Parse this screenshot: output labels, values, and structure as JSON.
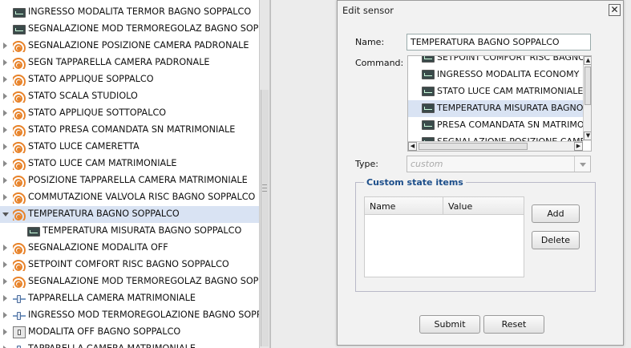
{
  "tree": {
    "items": [
      {
        "label": "INGRESSO MODALITA TERMOR BAGNO SOPPALCO",
        "icon": "sensor-monitor-icon",
        "expander": "none",
        "indent": 1,
        "selected": false
      },
      {
        "label": "SEGNALAZIONE MOD TERMOREGOLAZ BAGNO SOPPA",
        "icon": "sensor-monitor-icon",
        "expander": "none",
        "indent": 1,
        "selected": false
      },
      {
        "label": "SEGNALAZIONE POSIZIONE CAMERA PADRONALE",
        "icon": "signal-icon",
        "expander": "collapsed",
        "indent": 0,
        "selected": false
      },
      {
        "label": "SEGN TAPPARELLA CAMERA PADRONALE",
        "icon": "signal-icon",
        "expander": "collapsed",
        "indent": 0,
        "selected": false
      },
      {
        "label": "STATO APPLIQUE SOPPALCO",
        "icon": "signal-icon",
        "expander": "collapsed",
        "indent": 0,
        "selected": false
      },
      {
        "label": "STATO SCALA STUDIOLO",
        "icon": "signal-icon",
        "expander": "collapsed",
        "indent": 0,
        "selected": false
      },
      {
        "label": "STATO APPLIQUE SOTTOPALCO",
        "icon": "signal-icon",
        "expander": "collapsed",
        "indent": 0,
        "selected": false
      },
      {
        "label": "STATO PRESA COMANDATA SN MATRIMONIALE",
        "icon": "signal-icon",
        "expander": "collapsed",
        "indent": 0,
        "selected": false
      },
      {
        "label": "STATO LUCE CAMERETTA",
        "icon": "signal-icon",
        "expander": "collapsed",
        "indent": 0,
        "selected": false
      },
      {
        "label": "STATO LUCE CAM MATRIMONIALE",
        "icon": "signal-icon",
        "expander": "collapsed",
        "indent": 0,
        "selected": false
      },
      {
        "label": "POSIZIONE TAPPARELLA CAMERA MATRIMONIALE",
        "icon": "signal-icon",
        "expander": "collapsed",
        "indent": 0,
        "selected": false
      },
      {
        "label": "COMMUTAZIONE VALVOLA RISC BAGNO SOPPALCO",
        "icon": "signal-icon",
        "expander": "collapsed",
        "indent": 0,
        "selected": false
      },
      {
        "label": "TEMPERATURA BAGNO SOPPALCO",
        "icon": "signal-icon",
        "expander": "expanded",
        "indent": 0,
        "selected": true
      },
      {
        "label": "TEMPERATURA MISURATA BAGNO SOPPALCO",
        "icon": "sensor-monitor-icon",
        "expander": "none",
        "indent": 2,
        "selected": false
      },
      {
        "label": "SEGNALAZIONE MODALITA OFF",
        "icon": "signal-icon",
        "expander": "collapsed",
        "indent": 0,
        "selected": false
      },
      {
        "label": "SETPOINT COMFORT RISC BAGNO SOPPALCO",
        "icon": "signal-icon",
        "expander": "collapsed",
        "indent": 0,
        "selected": false
      },
      {
        "label": "SEGNALAZIONE MOD TERMOREGOLAZ BAGNO SOPP",
        "icon": "signal-icon",
        "expander": "collapsed",
        "indent": 0,
        "selected": false
      },
      {
        "label": "TAPPARELLA CAMERA MATRIMONIALE",
        "icon": "slider-icon",
        "expander": "collapsed",
        "indent": 0,
        "selected": false
      },
      {
        "label": "INGRESSO MOD TERMOREGOLAZIONE BAGNO SOPP",
        "icon": "slider-icon",
        "expander": "collapsed",
        "indent": 0,
        "selected": false
      },
      {
        "label": "MODALITA OFF BAGNO SOPPALCO",
        "icon": "switch-icon",
        "expander": "collapsed",
        "indent": 0,
        "selected": false
      },
      {
        "label": "TAPPARELLA CAMERA MATRIMONIALE",
        "icon": "slider-icon",
        "expander": "collapsed",
        "indent": 0,
        "selected": false
      }
    ]
  },
  "dialog": {
    "title": "Edit sensor",
    "close_label": "✕",
    "name_label": "Name:",
    "name_value": "TEMPERATURA BAGNO SOPPALCO",
    "command_label": "Command:",
    "commands": [
      {
        "label": "SETPOINT COMFORT RISC BAGNO SOPPALCO",
        "selected": false
      },
      {
        "label": "INGRESSO MODALITA ECONOMY",
        "selected": false
      },
      {
        "label": "STATO LUCE CAM MATRIMONIALE",
        "selected": false
      },
      {
        "label": "TEMPERATURA MISURATA BAGNO SOPPALCO",
        "selected": true
      },
      {
        "label": "PRESA COMANDATA SN MATRIMONIALE",
        "selected": false
      },
      {
        "label": "SEGNALAZIONE POSIZIONE CAMERA",
        "selected": false
      }
    ],
    "type_label": "Type:",
    "type_value": "custom",
    "custom_state_legend": "Custom state items",
    "grid_headers": {
      "name": "Name",
      "value": "Value"
    },
    "add_label": "Add",
    "delete_label": "Delete",
    "submit_label": "Submit",
    "reset_label": "Reset"
  },
  "colors": {
    "selection": "#d9e3f3",
    "legend_text": "#1c4e8a",
    "signal_icon": "#e8832a"
  }
}
